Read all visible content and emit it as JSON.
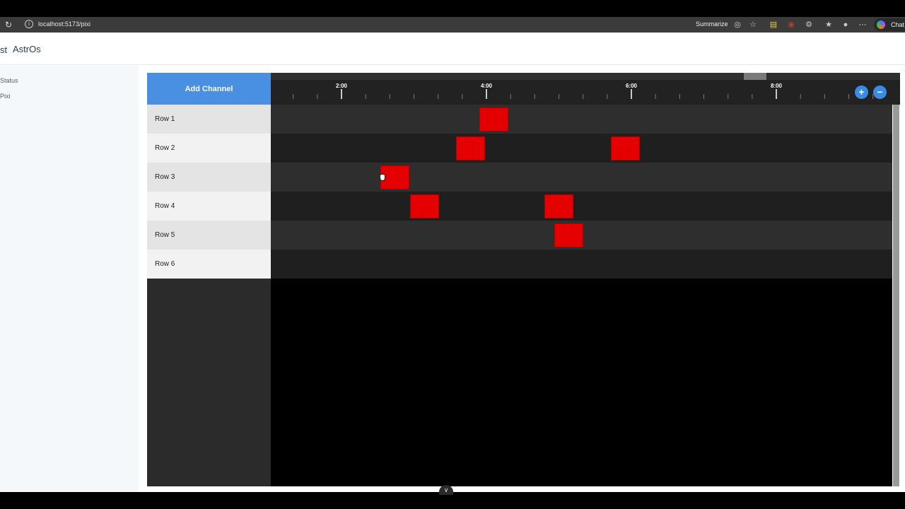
{
  "browser": {
    "url": "localhost:5173/pixi",
    "summarize_label": "Summarize",
    "chat_label": "Chat"
  },
  "app": {
    "brand_cut": "st",
    "brand": "AstrOs",
    "nav": [
      "Status",
      "Pixi"
    ]
  },
  "timeline": {
    "add_channel_label": "Add Channel",
    "time_labels": [
      "2:00",
      "4:00",
      "6:00",
      "8:00"
    ],
    "zoom_in_label": "+",
    "zoom_out_label": "−",
    "rows": [
      "Row 1",
      "Row 2",
      "Row 3",
      "Row 4",
      "Row 5",
      "Row 6"
    ]
  },
  "colors": {
    "accent": "#4a90e2",
    "block": "#e40000",
    "row_label_light": "#f2f2f2",
    "row_label_dark": "#e4e4e4",
    "lane_light": "#2e2e2e",
    "lane_dark": "#1f1f1f"
  }
}
